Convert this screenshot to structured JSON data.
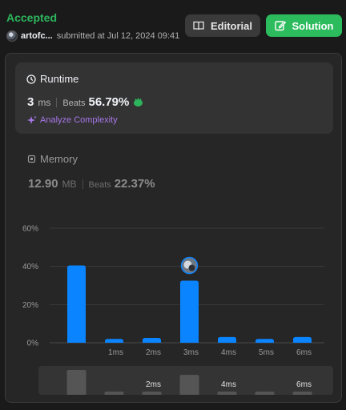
{
  "header": {
    "status": "Accepted",
    "user": "artofc...",
    "submitted_text": "submitted at Jul 12, 2024 09:41",
    "editorial_label": "Editorial",
    "solution_label": "Solution"
  },
  "runtime": {
    "title": "Runtime",
    "value": "3",
    "unit": "ms",
    "beats_label": "Beats",
    "beats_value": "56.79%",
    "analyze_label": "Analyze Complexity"
  },
  "memory": {
    "title": "Memory",
    "value": "12.90",
    "unit": "MB",
    "beats_label": "Beats",
    "beats_value": "22.37%"
  },
  "colors": {
    "accepted": "#2db55d",
    "solution_button": "#2cbb5d",
    "bar": "#0a84ff",
    "analyze": "#a777e8",
    "panel_bg": "#262626"
  },
  "chart_data": {
    "type": "bar",
    "title": "",
    "xlabel": "",
    "ylabel": "",
    "y_ticks": [
      "60%",
      "40%",
      "20%",
      "0%"
    ],
    "ylim": [
      0,
      60
    ],
    "grid": true,
    "categories": [
      "",
      "1ms",
      "2ms",
      "3ms",
      "4ms",
      "5ms",
      "6ms"
    ],
    "values": [
      40.5,
      2,
      2.5,
      32.5,
      3,
      2,
      3
    ],
    "highlight_category": "3ms",
    "minimap_labels": [
      "",
      "",
      "2ms",
      "",
      "4ms",
      "",
      "6ms"
    ]
  }
}
